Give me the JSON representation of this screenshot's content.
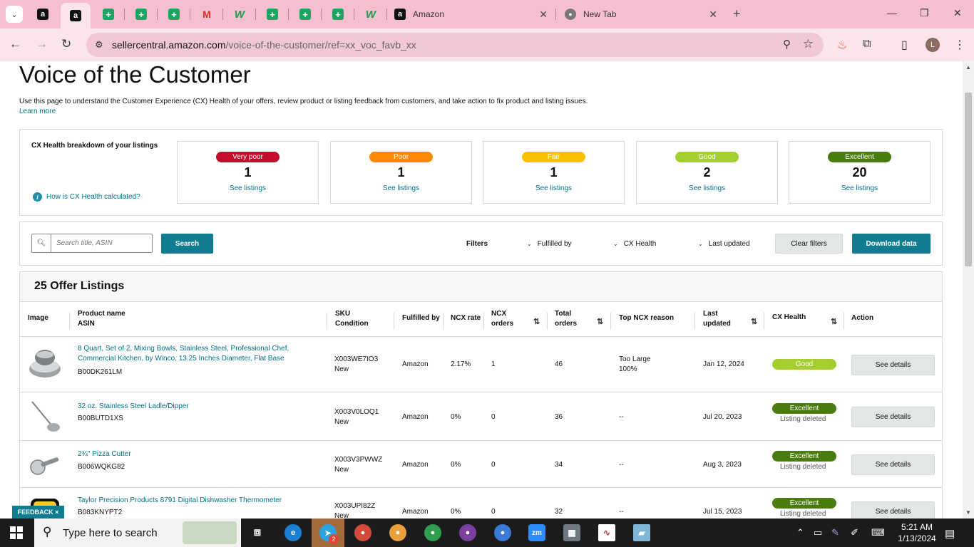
{
  "browser": {
    "tabs": [
      {
        "title": "Amazon"
      },
      {
        "title": "New Tab"
      }
    ],
    "url_host": "sellercentral.amazon.com",
    "url_path": "/voice-of-the-customer/ref=xx_voc_favb_xx",
    "profile_initial": "L"
  },
  "page": {
    "title": "Voice of the Customer",
    "intro": "Use this page to understand the Customer Experience (CX) Health of your offers, review product or listing feedback from customers, and take action to fix product and listing issues.",
    "learn_more": "Learn more",
    "cx": {
      "label": "CX Health breakdown of your listings",
      "how": "How is CX Health calculated?",
      "cards": [
        {
          "label": "Very poor",
          "count": "1",
          "link": "See listings",
          "color": "#c40c2d"
        },
        {
          "label": "Poor",
          "count": "1",
          "link": "See listings",
          "color": "#fb8a06"
        },
        {
          "label": "Fair",
          "count": "1",
          "link": "See listings",
          "color": "#f9c100"
        },
        {
          "label": "Good",
          "count": "2",
          "link": "See listings",
          "color": "#a4cf30"
        },
        {
          "label": "Excellent",
          "count": "20",
          "link": "See listings",
          "color": "#4a7b0e"
        }
      ]
    },
    "filters": {
      "search_placeholder": "Search title, ASIN",
      "search_button": "Search",
      "label": "Filters",
      "fulfilled_by": "Fulfilled by",
      "cx_health": "CX Health",
      "last_updated": "Last updated",
      "clear": "Clear filters",
      "download": "Download data"
    },
    "listings": {
      "title": "25 Offer Listings",
      "headers": {
        "image": "Image",
        "product": "Product name",
        "asin": "ASIN",
        "sku": "SKU",
        "condition": "Condition",
        "fulfilled": "Fulfilled by",
        "ncx_rate": "NCX rate",
        "ncx_orders_1": "NCX",
        "ncx_orders_2": "orders",
        "total_1": "Total",
        "total_2": "orders",
        "reason": "Top NCX reason",
        "updated_1": "Last",
        "updated_2": "updated",
        "health": "CX Health",
        "action": "Action"
      },
      "rows": [
        {
          "name_1": "8 Quart, Set of 2, Mixing Bowls, Stainless Steel, Professional Chef,",
          "name_2": "Commercial Kitchen, by Winco, 13.25 Inches Diameter, Flat Base",
          "asin": "B00DK261LM",
          "sku": "X003WE7IO3",
          "condition": "New",
          "fulfilled": "Amazon",
          "ncx_rate": "2.17%",
          "ncx_orders": "1",
          "total": "46",
          "reason_1": "Too Large",
          "reason_2": "100%",
          "updated": "Jan 12, 2024",
          "health": "Good",
          "health_color": "#a4cf30",
          "status": "",
          "action": "See details"
        },
        {
          "name_1": "32 oz. Stainless Steel Ladle/Dipper",
          "name_2": "",
          "asin": "B00BUTD1XS",
          "sku": "X003V0LOQ1",
          "condition": "New",
          "fulfilled": "Amazon",
          "ncx_rate": "0%",
          "ncx_orders": "0",
          "total": "36",
          "reason_1": "--",
          "reason_2": "",
          "updated": "Jul 20, 2023",
          "health": "Excellent",
          "health_color": "#4a7b0e",
          "status": "Listing deleted",
          "action": "See details"
        },
        {
          "name_1": "2¾\" Pizza Cutter",
          "name_2": "",
          "asin": "B006WQKG82",
          "sku": "X003V3PWWZ",
          "condition": "New",
          "fulfilled": "Amazon",
          "ncx_rate": "0%",
          "ncx_orders": "0",
          "total": "34",
          "reason_1": "--",
          "reason_2": "",
          "updated": "Aug 3, 2023",
          "health": "Excellent",
          "health_color": "#4a7b0e",
          "status": "Listing deleted",
          "action": "See details"
        },
        {
          "name_1": "Taylor Precision Products 8791 Digital Dishwasher Thermometer",
          "name_2": "",
          "asin": "B083KNYPT2",
          "sku": "X003UPI82Z",
          "condition": "New",
          "fulfilled": "Amazon",
          "ncx_rate": "0%",
          "ncx_orders": "0",
          "total": "32",
          "reason_1": "--",
          "reason_2": "",
          "updated": "Jul 15, 2023",
          "health": "Excellent",
          "health_color": "#4a7b0e",
          "status": "Listing deleted",
          "action": "See details"
        }
      ]
    },
    "feedback": "FEEDBACK ×"
  },
  "taskbar": {
    "search_placeholder": "Type here to search",
    "time": "5:21 AM",
    "date": "1/13/2024",
    "telegram_badge": "2"
  }
}
